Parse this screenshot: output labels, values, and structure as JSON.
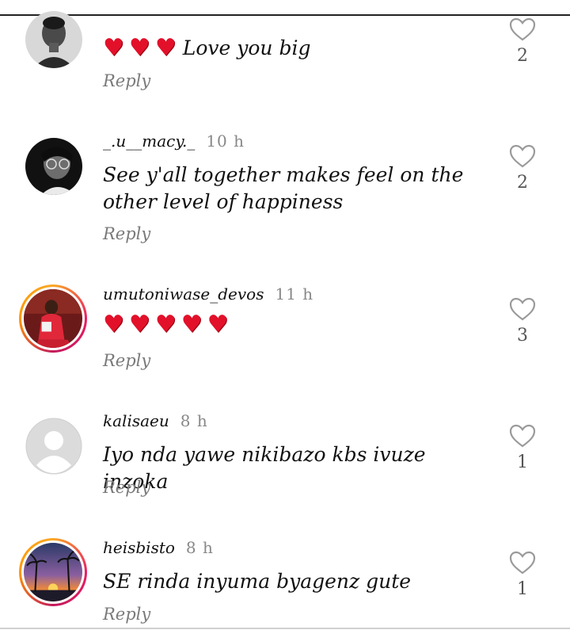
{
  "comments": [
    {
      "username": "",
      "time": "",
      "text": "Love you big",
      "hearts": 3,
      "likes": "2",
      "reply_label": "Reply",
      "avatar": "woman-portrait-grayscale",
      "ring": false
    },
    {
      "username": "_.u__macy._",
      "time": "10 h",
      "text": "See y'all together makes feel on the other level of happiness",
      "hearts": 0,
      "likes": "2",
      "reply_label": "Reply",
      "avatar": "woman-glasses-bw",
      "ring": false
    },
    {
      "username": "umutoniwase_devos",
      "time": "11 h",
      "text": "",
      "hearts": 5,
      "likes": "3",
      "reply_label": "Reply",
      "avatar": "woman-red-outfit",
      "ring": true
    },
    {
      "username": "kalisaeu",
      "time": "8 h",
      "text": "Iyo nda yawe  nikibazo kbs ivuze inzoka",
      "hearts": 0,
      "likes": "1",
      "reply_label": "Reply",
      "avatar": "default-user",
      "ring": false
    },
    {
      "username": "heisbisto",
      "time": "8 h",
      "text": "SE rinda inyuma byagenz gute",
      "hearts": 0,
      "likes": "1",
      "reply_label": "Reply",
      "avatar": "palm-sunset",
      "ring": true
    }
  ],
  "icons": {
    "like": "heart-outline-icon",
    "emoji": "red-heart-emoji"
  },
  "colors": {
    "heart_emoji": "#e3102a",
    "ring_start": "#f9a825",
    "ring_end": "#e91e63",
    "muted": "#888888"
  }
}
